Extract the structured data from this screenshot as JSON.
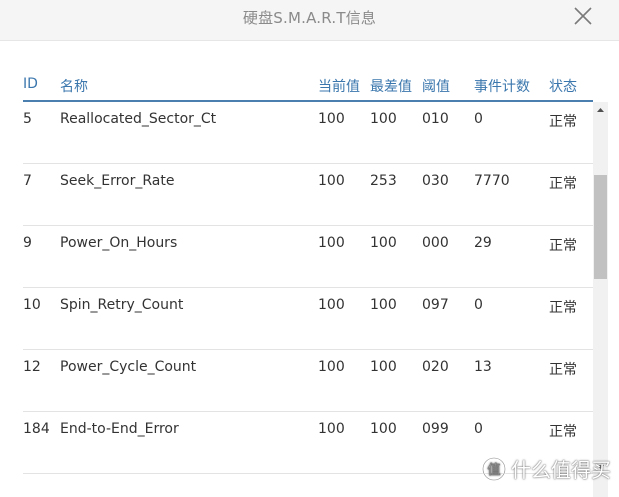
{
  "dialog": {
    "title": "硬盘S.M.A.R.T信息"
  },
  "table": {
    "headers": {
      "id": "ID",
      "name": "名称",
      "current": "当前值",
      "worst": "最差值",
      "threshold": "阈值",
      "event_count": "事件计数",
      "status": "状态"
    },
    "rows": [
      {
        "id": "5",
        "name": "Reallocated_Sector_Ct",
        "current": "100",
        "worst": "100",
        "threshold": "010",
        "event_count": "0",
        "status": "正常"
      },
      {
        "id": "7",
        "name": "Seek_Error_Rate",
        "current": "100",
        "worst": "253",
        "threshold": "030",
        "event_count": "7770",
        "status": "正常"
      },
      {
        "id": "9",
        "name": "Power_On_Hours",
        "current": "100",
        "worst": "100",
        "threshold": "000",
        "event_count": "29",
        "status": "正常"
      },
      {
        "id": "10",
        "name": "Spin_Retry_Count",
        "current": "100",
        "worst": "100",
        "threshold": "097",
        "event_count": "0",
        "status": "正常"
      },
      {
        "id": "12",
        "name": "Power_Cycle_Count",
        "current": "100",
        "worst": "100",
        "threshold": "020",
        "event_count": "13",
        "status": "正常"
      },
      {
        "id": "184",
        "name": "End-to-End_Error",
        "current": "100",
        "worst": "100",
        "threshold": "099",
        "event_count": "0",
        "status": "正常"
      }
    ]
  },
  "watermark": {
    "text": "什么值得买"
  },
  "icons": {
    "close": "close-icon",
    "scroll_up": "arrow-up-icon",
    "scroll_down": "arrow-down-icon",
    "watermark_logo": "logo-icon"
  }
}
